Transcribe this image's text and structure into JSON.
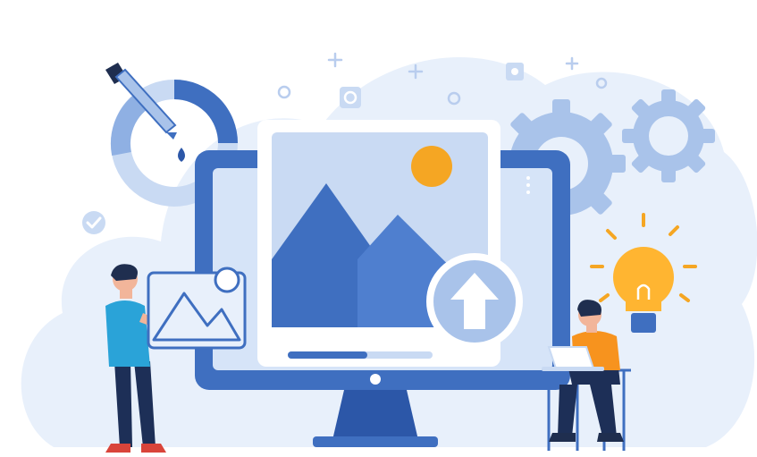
{
  "illustration": {
    "subject": "image-upload-illustration",
    "colors": {
      "cloud": "#e8f0fb",
      "primary": "#3f6fc0",
      "primary_dark": "#2c57a8",
      "light_blue": "#c9daf3",
      "mid_blue": "#8fb0e3",
      "accent_orange": "#f5a623",
      "bulb_yellow": "#ffb531",
      "skin": "#f2b59a",
      "hair": "#1f2e4f",
      "shirt_teal": "#2aa3d8",
      "shirt_orange": "#f7931e",
      "pants": "#1d2f57",
      "shoe_red": "#d9443a"
    },
    "upload_progress": 0.55,
    "icons": [
      "gear-icon",
      "gear-icon",
      "lightbulb-icon",
      "upload-arrow-icon",
      "checkmark-icon",
      "eyedropper-icon",
      "image-icon",
      "laptop-icon"
    ]
  }
}
